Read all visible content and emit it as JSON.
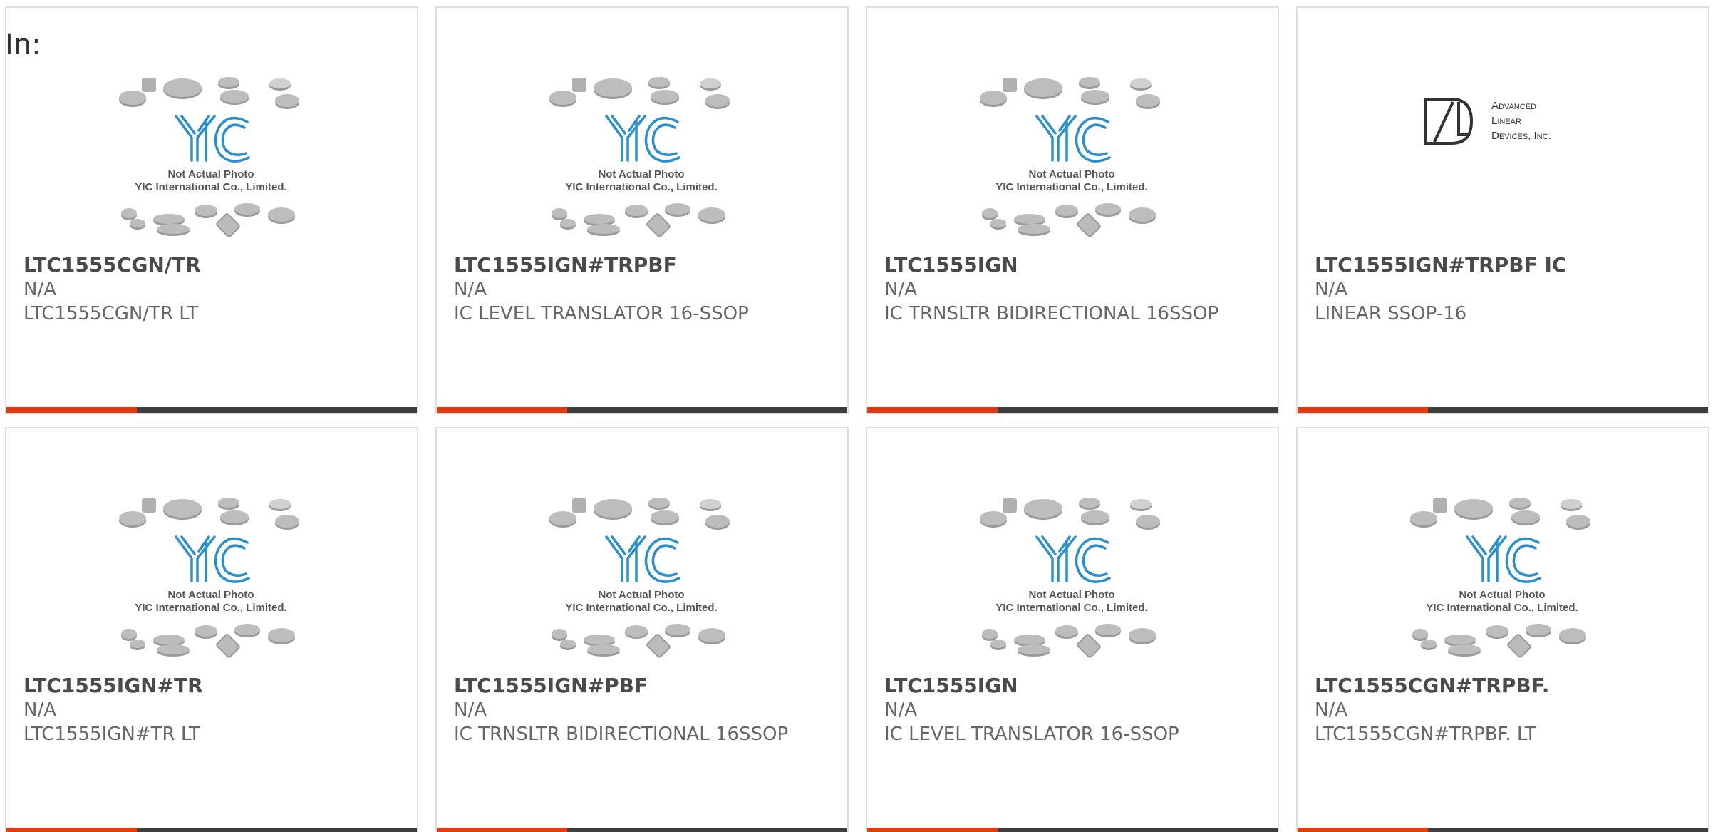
{
  "filter": {
    "label": "In:"
  },
  "products": [
    {
      "part_no": "LTC1555CGN/TR",
      "brand": "N/A",
      "description": "LTC1555CGN/TR LT",
      "image": "yic-placeholder",
      "image_caption_1": "Not Actual Photo",
      "image_caption_2": "YIC International Co., Limited."
    },
    {
      "part_no": "LTC1555IGN#TRPBF",
      "brand": "N/A",
      "description": "IC LEVEL TRANSLATOR 16-SSOP",
      "image": "yic-placeholder",
      "image_caption_1": "Not Actual Photo",
      "image_caption_2": "YIC International Co., Limited."
    },
    {
      "part_no": "LTC1555IGN",
      "brand": "N/A",
      "description": "IC TRNSLTR BIDIRECTIONAL 16SSOP",
      "image": "yic-placeholder",
      "image_caption_1": "Not Actual Photo",
      "image_caption_2": "YIC International Co., Limited."
    },
    {
      "part_no": "LTC1555IGN#TRPBF IC",
      "brand": "N/A",
      "description": "LINEAR SSOP-16",
      "image": "ald-logo",
      "logo_line_1": "Advanced",
      "logo_line_2": "Linear",
      "logo_line_3": "Devices, Inc."
    },
    {
      "part_no": "LTC1555IGN#TR",
      "brand": "N/A",
      "description": "LTC1555IGN#TR LT",
      "image": "yic-placeholder",
      "image_caption_1": "Not Actual Photo",
      "image_caption_2": "YIC International Co., Limited."
    },
    {
      "part_no": "LTC1555IGN#PBF",
      "brand": "N/A",
      "description": "IC TRNSLTR BIDIRECTIONAL 16SSOP",
      "image": "yic-placeholder",
      "image_caption_1": "Not Actual Photo",
      "image_caption_2": "YIC International Co., Limited."
    },
    {
      "part_no": "LTC1555IGN",
      "brand": "N/A",
      "description": "IC LEVEL TRANSLATOR 16-SSOP",
      "image": "yic-placeholder",
      "image_caption_1": "Not Actual Photo",
      "image_caption_2": "YIC International Co., Limited."
    },
    {
      "part_no": "LTC1555CGN#TRPBF.",
      "brand": "N/A",
      "description": "LTC1555CGN#TRPBF. LT",
      "image": "yic-placeholder",
      "image_caption_1": "Not Actual Photo",
      "image_caption_2": "YIC International Co., Limited."
    }
  ],
  "colors": {
    "accent": "#e8380d",
    "bar": "#3d3d3d",
    "yic_blue": "#2a8fd0"
  }
}
